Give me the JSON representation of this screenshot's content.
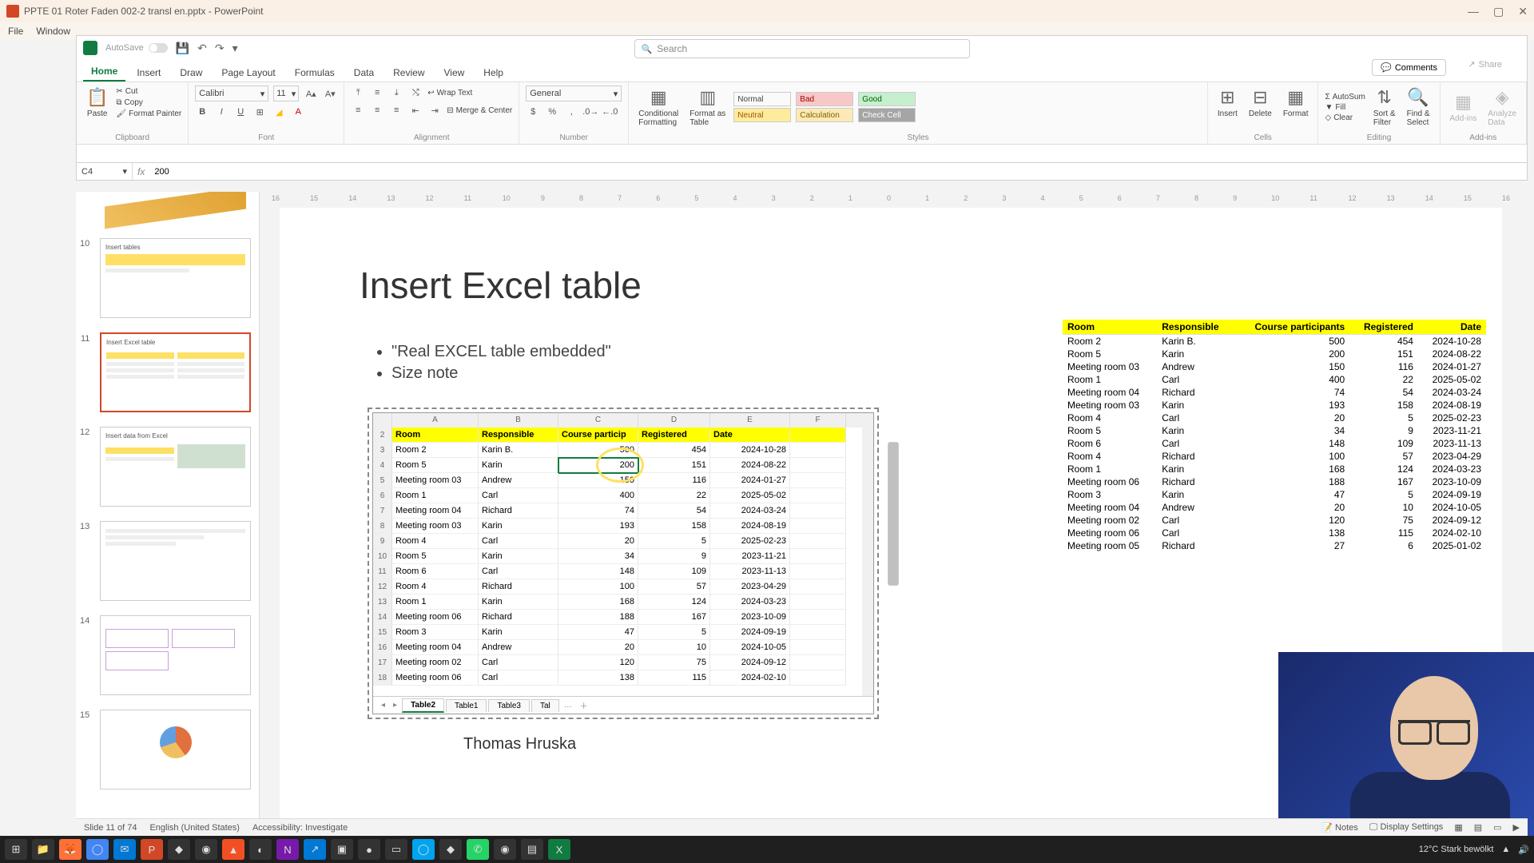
{
  "pp": {
    "title": "PPTE 01 Roter Faden 002-2 transl en.pptx - PowerPoint",
    "menu": [
      "File",
      "Window"
    ]
  },
  "xl": {
    "autosave": "AutoSave",
    "search_ph": "Search",
    "tabs": [
      "Home",
      "Insert",
      "Draw",
      "Page Layout",
      "Formulas",
      "Data",
      "Review",
      "View",
      "Help"
    ],
    "comments": "Comments",
    "share": "Share",
    "namebox": "C4",
    "formula": "200",
    "groups": {
      "clipboard": "Clipboard",
      "font": "Font",
      "alignment": "Alignment",
      "number": "Number",
      "styles": "Styles",
      "cells": "Cells",
      "editing": "Editing",
      "addins": "Add-ins"
    },
    "paste": "Paste",
    "cut": "Cut",
    "copy": "Copy",
    "fp": "Format Painter",
    "fontname": "Calibri",
    "fontsize": "11",
    "wrap": "Wrap Text",
    "merge": "Merge & Center",
    "numfmt": "General",
    "cf": "Conditional\nFormatting",
    "fat": "Format as\nTable",
    "sty_normal": "Normal",
    "sty_bad": "Bad",
    "sty_good": "Good",
    "sty_neutral": "Neutral",
    "sty_calc": "Calculation",
    "sty_check": "Check Cell",
    "insert": "Insert",
    "delete": "Delete",
    "format": "Format",
    "autosum": "AutoSum",
    "fill": "Fill",
    "clear": "Clear",
    "sortf": "Sort &\nFilter",
    "finds": "Find &\nSelect",
    "addins_btn": "Add-ins",
    "analyze": "Analyze\nData"
  },
  "thumbs": [
    {
      "n": "10",
      "title": "Insert tables"
    },
    {
      "n": "11",
      "title": "Insert Excel table"
    },
    {
      "n": "12",
      "title": "Insert data from Excel"
    },
    {
      "n": "13",
      "title": ""
    },
    {
      "n": "14",
      "title": ""
    },
    {
      "n": "15",
      "title": ""
    }
  ],
  "slide": {
    "title": "Insert Excel table",
    "b1": "\"Real EXCEL table embedded\"",
    "b2": "Size note",
    "author": "Thomas Hruska"
  },
  "embed": {
    "cols": [
      "A",
      "B",
      "C",
      "D",
      "E",
      "F"
    ],
    "hdr": {
      "A": "Room",
      "B": "Responsible",
      "C": "Course particip",
      "D": "Registered",
      "E": "Date"
    },
    "rows": [
      {
        "n": 3,
        "A": "Room 2",
        "B": "Karin B.",
        "C": "500",
        "D": "454",
        "E": "2024-10-28"
      },
      {
        "n": 4,
        "A": "Room 5",
        "B": "Karin",
        "C": "200",
        "D": "151",
        "E": "2024-08-22"
      },
      {
        "n": 5,
        "A": "Meeting room 03",
        "B": "Andrew",
        "C": "150",
        "D": "116",
        "E": "2024-01-27"
      },
      {
        "n": 6,
        "A": "Room 1",
        "B": "Carl",
        "C": "400",
        "D": "22",
        "E": "2025-05-02"
      },
      {
        "n": 7,
        "A": "Meeting room 04",
        "B": "Richard",
        "C": "74",
        "D": "54",
        "E": "2024-03-24"
      },
      {
        "n": 8,
        "A": "Meeting room 03",
        "B": "Karin",
        "C": "193",
        "D": "158",
        "E": "2024-08-19"
      },
      {
        "n": 9,
        "A": "Room 4",
        "B": "Carl",
        "C": "20",
        "D": "5",
        "E": "2025-02-23"
      },
      {
        "n": 10,
        "A": "Room 5",
        "B": "Karin",
        "C": "34",
        "D": "9",
        "E": "2023-11-21"
      },
      {
        "n": 11,
        "A": "Room 6",
        "B": "Carl",
        "C": "148",
        "D": "109",
        "E": "2023-11-13"
      },
      {
        "n": 12,
        "A": "Room 4",
        "B": "Richard",
        "C": "100",
        "D": "57",
        "E": "2023-04-29"
      },
      {
        "n": 13,
        "A": "Room 1",
        "B": "Karin",
        "C": "168",
        "D": "124",
        "E": "2024-03-23"
      },
      {
        "n": 14,
        "A": "Meeting room 06",
        "B": "Richard",
        "C": "188",
        "D": "167",
        "E": "2023-10-09"
      },
      {
        "n": 15,
        "A": "Room 3",
        "B": "Karin",
        "C": "47",
        "D": "5",
        "E": "2024-09-19"
      },
      {
        "n": 16,
        "A": "Meeting room 04",
        "B": "Andrew",
        "C": "20",
        "D": "10",
        "E": "2024-10-05"
      },
      {
        "n": 17,
        "A": "Meeting room 02",
        "B": "Carl",
        "C": "120",
        "D": "75",
        "E": "2024-09-12"
      },
      {
        "n": 18,
        "A": "Meeting room 06",
        "B": "Carl",
        "C": "138",
        "D": "115",
        "E": "2024-02-10"
      }
    ],
    "sheets": [
      "Table2",
      "Table1",
      "Table3",
      "Tal"
    ]
  },
  "rtable": {
    "hdr": [
      "Room",
      "Responsible",
      "Course participants",
      "Registered",
      "Date"
    ],
    "rows": [
      [
        "Room 2",
        "Karin B.",
        "500",
        "454",
        "2024-10-28"
      ],
      [
        "Room 5",
        "Karin",
        "200",
        "151",
        "2024-08-22"
      ],
      [
        "Meeting room 03",
        "Andrew",
        "150",
        "116",
        "2024-01-27"
      ],
      [
        "Room 1",
        "Carl",
        "400",
        "22",
        "2025-05-02"
      ],
      [
        "Meeting room 04",
        "Richard",
        "74",
        "54",
        "2024-03-24"
      ],
      [
        "Meeting room 03",
        "Karin",
        "193",
        "158",
        "2024-08-19"
      ],
      [
        "Room 4",
        "Carl",
        "20",
        "5",
        "2025-02-23"
      ],
      [
        "Room 5",
        "Karin",
        "34",
        "9",
        "2023-11-21"
      ],
      [
        "Room 6",
        "Carl",
        "148",
        "109",
        "2023-11-13"
      ],
      [
        "Room 4",
        "Richard",
        "100",
        "57",
        "2023-04-29"
      ],
      [
        "Room 1",
        "Karin",
        "168",
        "124",
        "2024-03-23"
      ],
      [
        "Meeting room 06",
        "Richard",
        "188",
        "167",
        "2023-10-09"
      ],
      [
        "Room 3",
        "Karin",
        "47",
        "5",
        "2024-09-19"
      ],
      [
        "Meeting room 04",
        "Andrew",
        "20",
        "10",
        "2024-10-05"
      ],
      [
        "Meeting room 02",
        "Carl",
        "120",
        "75",
        "2024-09-12"
      ],
      [
        "Meeting room 06",
        "Carl",
        "138",
        "115",
        "2024-02-10"
      ],
      [
        "Meeting room 05",
        "Richard",
        "27",
        "6",
        "2025-01-02"
      ]
    ]
  },
  "status": {
    "slide": "Slide 11 of 74",
    "lang": "English (United States)",
    "access": "Accessibility: Investigate",
    "notes": "Notes",
    "display": "Display Settings"
  },
  "taskbar": {
    "weather": "12°C  Stark bewölkt"
  },
  "ruler": [
    "16",
    "15",
    "14",
    "13",
    "12",
    "11",
    "10",
    "9",
    "8",
    "7",
    "6",
    "5",
    "4",
    "3",
    "2",
    "1",
    "0",
    "1",
    "2",
    "3",
    "4",
    "5",
    "6",
    "7",
    "8",
    "9",
    "10",
    "11",
    "12",
    "13",
    "14",
    "15",
    "16"
  ]
}
